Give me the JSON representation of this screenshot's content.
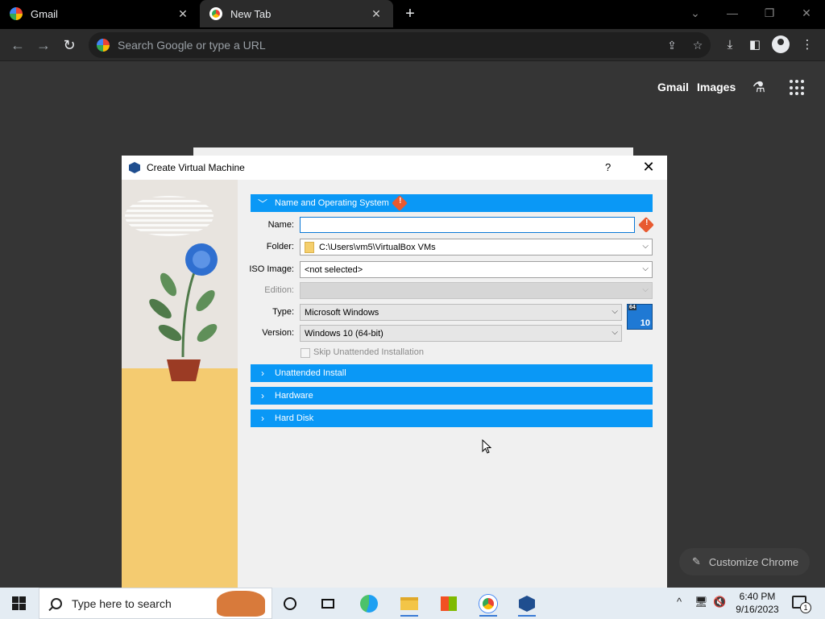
{
  "browser": {
    "tabs": [
      {
        "label": "Gmail",
        "icon": "google-icon"
      },
      {
        "label": "New Tab",
        "icon": "chrome-icon"
      }
    ],
    "omnibox_placeholder": "Search Google or type a URL",
    "ntp": {
      "gmail": "Gmail",
      "images": "Images"
    },
    "customize_label": "Customize Chrome"
  },
  "dialog": {
    "title": "Create Virtual Machine",
    "help": "?",
    "sections": {
      "name_os": "Name and Operating System",
      "unattended": "Unattended Install",
      "hardware": "Hardware",
      "hard_disk": "Hard Disk"
    },
    "labels": {
      "name": "Name:",
      "folder": "Folder:",
      "iso": "ISO Image:",
      "edition": "Edition:",
      "type": "Type:",
      "version": "Version:"
    },
    "values": {
      "name": "",
      "folder": "C:\\Users\\vm5\\VirtualBox VMs",
      "iso": "<not selected>",
      "edition": "",
      "type": "Microsoft Windows",
      "version": "Windows 10 (64-bit)"
    },
    "skip_unattended_label": "Skip Unattended Installation",
    "os_badge": {
      "bits": "64",
      "version": "10"
    }
  },
  "taskbar": {
    "search_placeholder": "Type here to search",
    "time": "6:40 PM",
    "date": "9/16/2023",
    "notifications": "1"
  },
  "colors": {
    "section_header": "#0a98f6",
    "warning": "#e85a30",
    "dark_bg": "#353535"
  }
}
